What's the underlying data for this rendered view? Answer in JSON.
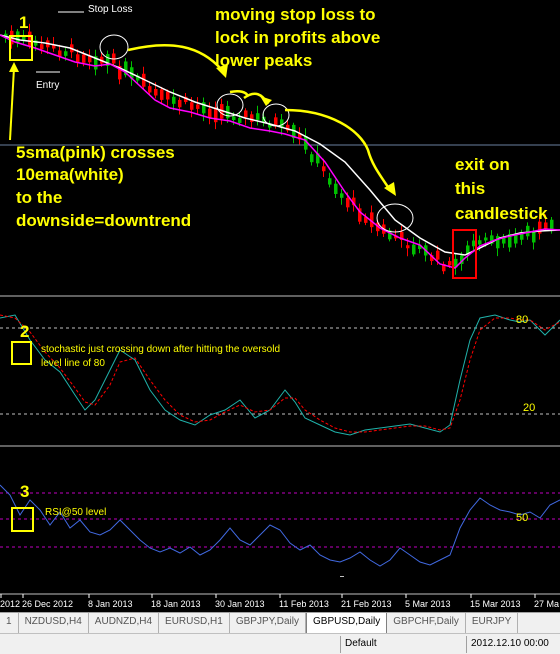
{
  "chart": {
    "stop_loss_label": "Stop Loss",
    "entry_label": "Entry",
    "marker_1": "1",
    "marker_2": "2",
    "marker_3": "3",
    "annotation_trailing": [
      "moving stop loss to",
      "lock in profits above",
      "lower peaks"
    ],
    "annotation_crossover": [
      "5sma(pink) crosses",
      "10ema(white)",
      "to the",
      "downside=downtrend"
    ],
    "annotation_exit": [
      "exit on",
      "this",
      "candlestick"
    ],
    "stoch_note": [
      "stochastic just crossing down after hitting the oversold",
      "level line of 80"
    ],
    "stoch_level_80": "80",
    "stoch_level_20": "20",
    "rsi_note": "RSI@50 level",
    "rsi_level_50": "50",
    "date_labels": [
      "2012",
      "26 Dec 2012",
      "8 Jan 2013",
      "18 Jan 2013",
      "30 Jan 2013",
      "11 Feb 2013",
      "21 Feb 2013",
      "5 Mar 2013",
      "15 Mar 2013",
      "27 Ma"
    ],
    "colors": {
      "bull": "#00c000",
      "bear": "#ff0000",
      "sma5": "#ff00ff",
      "ema10": "#ffffff",
      "annotation": "#ffff00",
      "rsi": "#4169e1",
      "stoch_main": "#20b2aa",
      "stoch_signal": "#ff0000"
    }
  },
  "tabs": [
    "1",
    "NZDUSD,H4",
    "AUDNZD,H4",
    "EURUSD,H1",
    "GBPJPY,Daily",
    "GBPUSD,Daily",
    "GBPCHF,Daily",
    "EURJPY"
  ],
  "active_tab": "GBPUSD,Daily",
  "status": {
    "profile": "Default",
    "datetime": "2012.12.10 00:00"
  }
}
